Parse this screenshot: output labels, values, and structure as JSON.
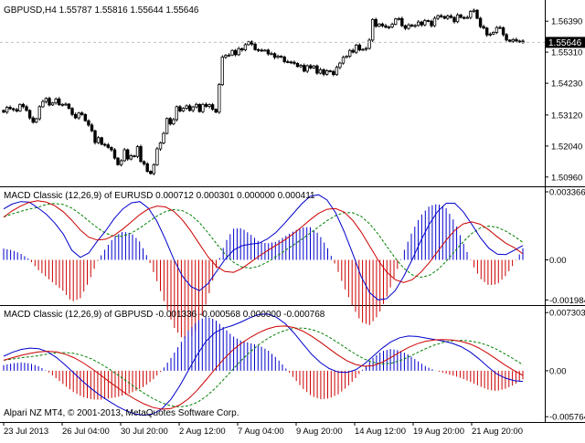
{
  "colors": {
    "background": "#ffffff",
    "axis": "#000000",
    "grid": "#c0c0c0",
    "candle_body": "#000000",
    "macd_main": "#0000cc",
    "macd_signal": "#cc0000",
    "macd_dashed": "#008000",
    "hist_positive": "#0000cc",
    "hist_negative": "#cc0000",
    "price_tag_bg": "#000000",
    "price_tag_text": "#ffffff"
  },
  "main_chart": {
    "header": "GBPUSD,H4  1.55787 1.55816 1.55644 1.55646",
    "price_ticks": [
      "1.56390",
      "1.55310",
      "1.54230",
      "1.53120",
      "1.52040",
      "1.50960"
    ],
    "current_price": "1.55646",
    "chart_data": {
      "type": "candlestick",
      "ylim": [
        1.507,
        1.57
      ],
      "close": [
        1.5322,
        1.5339,
        1.5334,
        1.5331,
        1.5326,
        1.5349,
        1.5341,
        1.5328,
        1.5302,
        1.5287,
        1.5299,
        1.5341,
        1.5359,
        1.537,
        1.5347,
        1.5354,
        1.5368,
        1.5348,
        1.5349,
        1.535,
        1.5335,
        1.5314,
        1.5302,
        1.5319,
        1.5314,
        1.5292,
        1.5277,
        1.5257,
        1.5216,
        1.5233,
        1.521,
        1.5208,
        1.5199,
        1.5191,
        1.5162,
        1.5139,
        1.5153,
        1.5191,
        1.5159,
        1.517,
        1.5168,
        1.5202,
        1.515,
        1.5142,
        1.5116,
        1.5108,
        1.5139,
        1.5194,
        1.5215,
        1.5248,
        1.53,
        1.5281,
        1.5296,
        1.5341,
        1.5326,
        1.5336,
        1.5344,
        1.5328,
        1.534,
        1.5349,
        1.5324,
        1.5349,
        1.5342,
        1.5348,
        1.5332,
        1.5322,
        1.5418,
        1.5514,
        1.552,
        1.5521,
        1.5537,
        1.5522,
        1.5543,
        1.5539,
        1.5557,
        1.5567,
        1.5559,
        1.554,
        1.5538,
        1.5537,
        1.5538,
        1.5525,
        1.5526,
        1.5513,
        1.5517,
        1.5514,
        1.5498,
        1.5497,
        1.5496,
        1.5492,
        1.5481,
        1.5485,
        1.5465,
        1.5484,
        1.5476,
        1.5483,
        1.5458,
        1.547,
        1.5454,
        1.5466,
        1.5464,
        1.5453,
        1.5478,
        1.5493,
        1.5513,
        1.5517,
        1.5537,
        1.5531,
        1.5556,
        1.5539,
        1.5541,
        1.5544,
        1.5573,
        1.5645,
        1.5621,
        1.5629,
        1.5623,
        1.5618,
        1.5619,
        1.5628,
        1.5647,
        1.5648,
        1.5623,
        1.5614,
        1.5626,
        1.5622,
        1.5624,
        1.5636,
        1.5626,
        1.5641,
        1.5639,
        1.5623,
        1.5649,
        1.5658,
        1.5655,
        1.5649,
        1.5657,
        1.5652,
        1.5637,
        1.5661,
        1.5652,
        1.5651,
        1.5652,
        1.5673,
        1.5677,
        1.5649,
        1.562,
        1.5615,
        1.5591,
        1.5594,
        1.56,
        1.5617,
        1.5616,
        1.5592,
        1.5573,
        1.5569,
        1.5575,
        1.557,
        1.557,
        1.5565
      ]
    }
  },
  "macd_eurusd": {
    "header": "MACD Classic (12,26,9) of EURUSD 0.000712 0.000301 0.000000 0.000411",
    "ticks": [
      "0.003366",
      "0.00",
      "-0.001984"
    ],
    "chart_data": {
      "type": "line",
      "ylim": [
        -0.0021,
        0.0035
      ],
      "series": [
        {
          "values": [
            0.00252,
            0.00276,
            0.00288,
            0.00286,
            0.00258,
            0.00226,
            0.00182,
            0.00128,
            0.00048,
            0.00012,
            0.00034,
            0.00092,
            0.00144,
            0.00204,
            0.00252,
            0.00282,
            0.00288,
            0.00256,
            0.00192,
            0.00102,
            2e-05,
            -0.0008,
            -0.00132,
            -0.00152,
            -0.00118,
            -0.00058,
            2e-05,
            0.00048,
            0.0007,
            0.00078,
            0.00082,
            0.00104,
            0.00136,
            0.0018,
            0.00228,
            0.00276,
            0.00314,
            0.00322,
            0.00296,
            0.00234,
            0.0014,
            0.00032,
            -0.00082,
            -0.00162,
            -0.00198,
            -0.00192,
            -0.00152,
            -0.00082,
            2e-05,
            0.00094,
            0.00176,
            0.0024,
            0.0028,
            0.0028,
            0.00238,
            0.00176,
            0.0011,
            0.00058,
            0.00028,
            0.00026,
            0.00048,
            0.00071
          ]
        },
        {
          "values": [
            0.00212,
            0.00242,
            0.00266,
            0.00284,
            0.00292,
            0.00286,
            0.00268,
            0.00238,
            0.00196,
            0.00148,
            0.00112,
            0.00098,
            0.00102,
            0.00122,
            0.00152,
            0.00188,
            0.00224,
            0.00252,
            0.00266,
            0.00262,
            0.0024,
            0.00198,
            0.00142,
            0.00078,
            0.00016,
            -0.00032,
            -0.00058,
            -0.00062,
            -0.00042,
            -0.00012,
            0.00018,
            0.00046,
            0.00072,
            0.00098,
            0.00128,
            0.00162,
            0.00198,
            0.0023,
            0.0025,
            0.00254,
            0.00236,
            0.00196,
            0.00138,
            0.00068,
            -2e-05,
            -0.0006,
            -0.00098,
            -0.00112,
            -0.00098,
            -0.00062,
            -0.00014,
            0.00042,
            0.00098,
            0.00146,
            0.00178,
            0.00188,
            0.00176,
            0.00148,
            0.00114,
            0.00082,
            0.0006,
            0.0003
          ]
        }
      ]
    }
  },
  "macd_gbpusd": {
    "header": "MACD Classic (12,26,9) of GBPUSD -0.001336 -0.000568 0.000000 -0.000768",
    "ticks": [
      "0.007303",
      "0.00",
      "-0.005764"
    ],
    "chart_data": {
      "type": "line",
      "ylim": [
        -0.0062,
        0.0079
      ],
      "series": [
        {
          "values": [
            0.00182,
            0.00232,
            0.00268,
            0.00284,
            0.00276,
            0.00238,
            0.00166,
            0.00072,
            -0.0003,
            -0.00134,
            -0.00228,
            -0.00312,
            -0.00384,
            -0.00452,
            -0.00506,
            -0.00544,
            -0.00558,
            -0.0054,
            -0.00476,
            -0.0036,
            -0.00194,
            6e-05,
            0.00202,
            0.0037,
            0.00478,
            0.00534,
            0.00568,
            0.00612,
            0.00666,
            0.00706,
            0.00712,
            0.00672,
            0.0059,
            0.00474,
            0.00338,
            0.00206,
            0.00102,
            0.00028,
            -0.00016,
            -0.00022,
            0.00012,
            0.00086,
            0.00184,
            0.00282,
            0.00362,
            0.00414,
            0.00436,
            0.0043,
            0.0041,
            0.00392,
            0.00372,
            0.00344,
            0.00302,
            0.00238,
            0.0015,
            0.00052,
            -0.00036,
            -0.00092,
            -0.00124,
            -0.00134
          ]
        },
        {
          "values": [
            0.00132,
            0.00164,
            0.00194,
            0.00218,
            0.00236,
            0.00244,
            0.00236,
            0.00208,
            0.00164,
            0.00102,
            0.00028,
            -0.00052,
            -0.00136,
            -0.00218,
            -0.00294,
            -0.00362,
            -0.00418,
            -0.00462,
            -0.00482,
            -0.00474,
            -0.0043,
            -0.00352,
            -0.00244,
            -0.00116,
            0.00018,
            0.00146,
            0.00256,
            0.00344,
            0.00418,
            0.00478,
            0.00526,
            0.00556,
            0.00562,
            0.00542,
            0.00498,
            0.00434,
            0.00358,
            0.00276,
            0.00196,
            0.00126,
            0.00078,
            0.00056,
            0.00066,
            0.00106,
            0.00166,
            0.00232,
            0.00292,
            0.0034,
            0.00372,
            0.00388,
            0.00392,
            0.00386,
            0.00368,
            0.00336,
            0.00286,
            0.0022,
            0.00146,
            0.0007,
            2e-05,
            -0.00057
          ]
        }
      ]
    }
  },
  "time_axis": [
    "23 Jul 2013",
    "26 Jul 04:00",
    "30 Jul 20:00",
    "2 Aug 12:00",
    "7 Aug 04:00",
    "9 Aug 20:00",
    "14 Aug 12:00",
    "19 Aug 20:00",
    "21 Aug 20:00"
  ],
  "copyright": "Alpari NZ MT4, © 2001-2013, MetaQuotes Software Corp."
}
